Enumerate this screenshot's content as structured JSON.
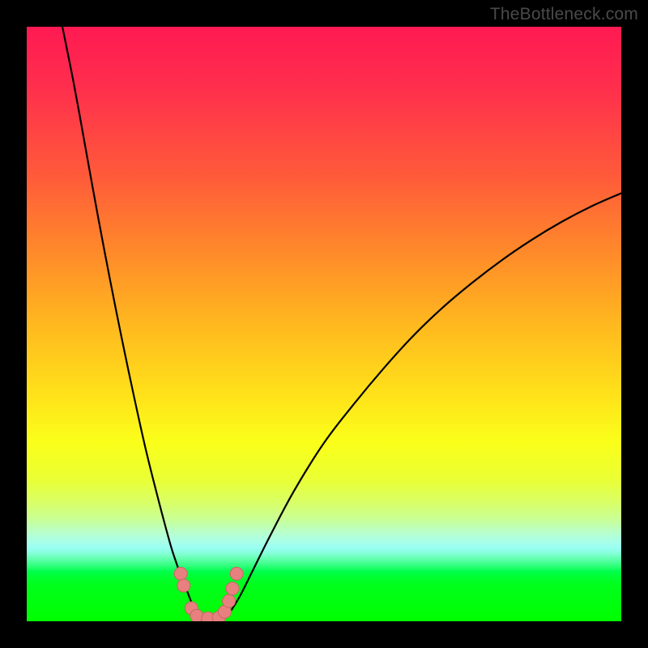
{
  "watermark": "TheBottleneck.com",
  "colors": {
    "curve": "#000000",
    "dot_fill": "#e98080",
    "dot_stroke": "#c86666"
  },
  "chart_data": {
    "type": "line",
    "title": "",
    "xlabel": "",
    "ylabel": "",
    "xlim": [
      0,
      100
    ],
    "ylim": [
      0,
      100
    ],
    "series": [
      {
        "name": "left_branch",
        "x": [
          6.0,
          8.0,
          10.0,
          12.0,
          14.0,
          16.0,
          18.0,
          20.0,
          22.0,
          24.0,
          25.0,
          26.0,
          27.0,
          27.7,
          28.3,
          29.0
        ],
        "y": [
          100.0,
          90.0,
          79.0,
          68.0,
          57.5,
          47.5,
          38.0,
          29.0,
          21.0,
          13.5,
          10.3,
          7.5,
          5.0,
          3.2,
          1.8,
          0.6
        ]
      },
      {
        "name": "right_branch",
        "x": [
          33.5,
          34.5,
          36.0,
          38.0,
          41.0,
          45.0,
          50.0,
          55.0,
          60.0,
          65.0,
          70.0,
          75.0,
          80.0,
          85.0,
          90.0,
          95.0,
          100.0
        ],
        "y": [
          0.6,
          2.0,
          4.5,
          8.5,
          14.5,
          22.0,
          30.0,
          36.5,
          42.5,
          48.0,
          52.8,
          57.0,
          60.8,
          64.2,
          67.2,
          69.8,
          72.0
        ]
      }
    ],
    "valley_points": [
      {
        "x": 25.9,
        "y": 8.0
      },
      {
        "x": 26.4,
        "y": 6.0
      },
      {
        "x": 27.7,
        "y": 2.2
      },
      {
        "x": 28.6,
        "y": 0.9
      },
      {
        "x": 30.5,
        "y": 0.5
      },
      {
        "x": 32.3,
        "y": 0.6
      },
      {
        "x": 33.3,
        "y": 1.6
      },
      {
        "x": 34.0,
        "y": 3.4
      },
      {
        "x": 34.6,
        "y": 5.5
      },
      {
        "x": 35.3,
        "y": 8.0
      }
    ],
    "dot_radius_px": 8
  }
}
